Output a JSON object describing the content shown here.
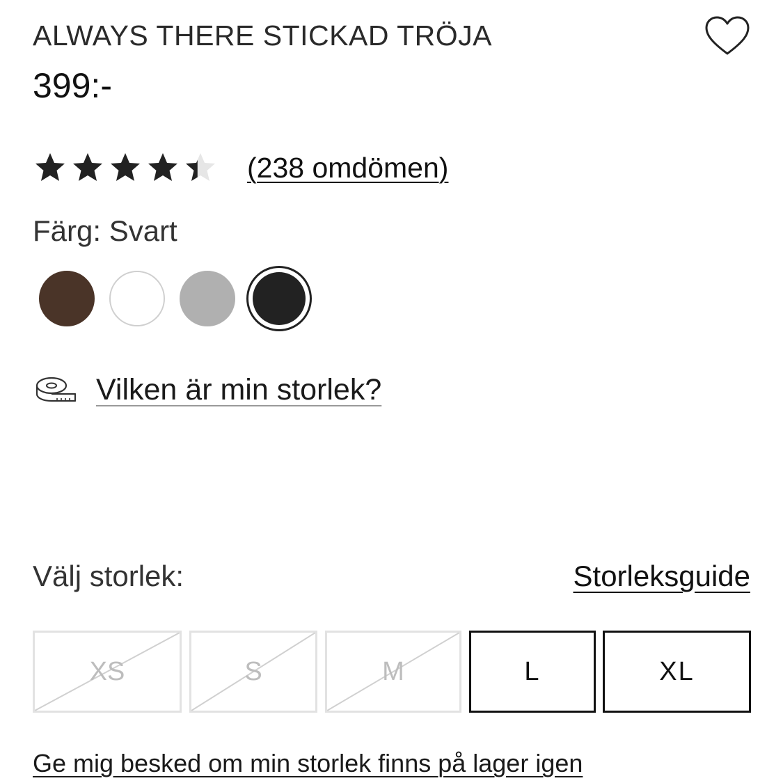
{
  "product": {
    "title": "ALWAYS THERE STICKAD TRÖJA",
    "price": "399:-",
    "favorite_icon": "heart-outline-icon"
  },
  "rating": {
    "value": 4.4,
    "max": 5,
    "reviews_label": "(238 omdömen)",
    "star_color": "#222222",
    "empty_star_color": "#e6e6e6"
  },
  "color": {
    "label": "Färg: Svart",
    "options": [
      {
        "name": "brown",
        "hex": "#4a3428",
        "selected": false
      },
      {
        "name": "white",
        "hex": "#ffffff",
        "selected": false
      },
      {
        "name": "grey",
        "hex": "#b0b0b0",
        "selected": false
      },
      {
        "name": "black",
        "hex": "#222222",
        "selected": true
      }
    ]
  },
  "size_help": {
    "icon": "measuring-tape-icon",
    "label": "Vilken är min storlek?"
  },
  "size": {
    "label": "Välj storlek:",
    "guide_label": "Storleksguide",
    "options": [
      {
        "label": "XS",
        "available": false
      },
      {
        "label": "S",
        "available": false
      },
      {
        "label": "M",
        "available": false
      },
      {
        "label": "L",
        "available": true
      },
      {
        "label": "XL",
        "available": true
      }
    ]
  },
  "notify_label": "Ge mig besked om min storlek finns på lager igen"
}
